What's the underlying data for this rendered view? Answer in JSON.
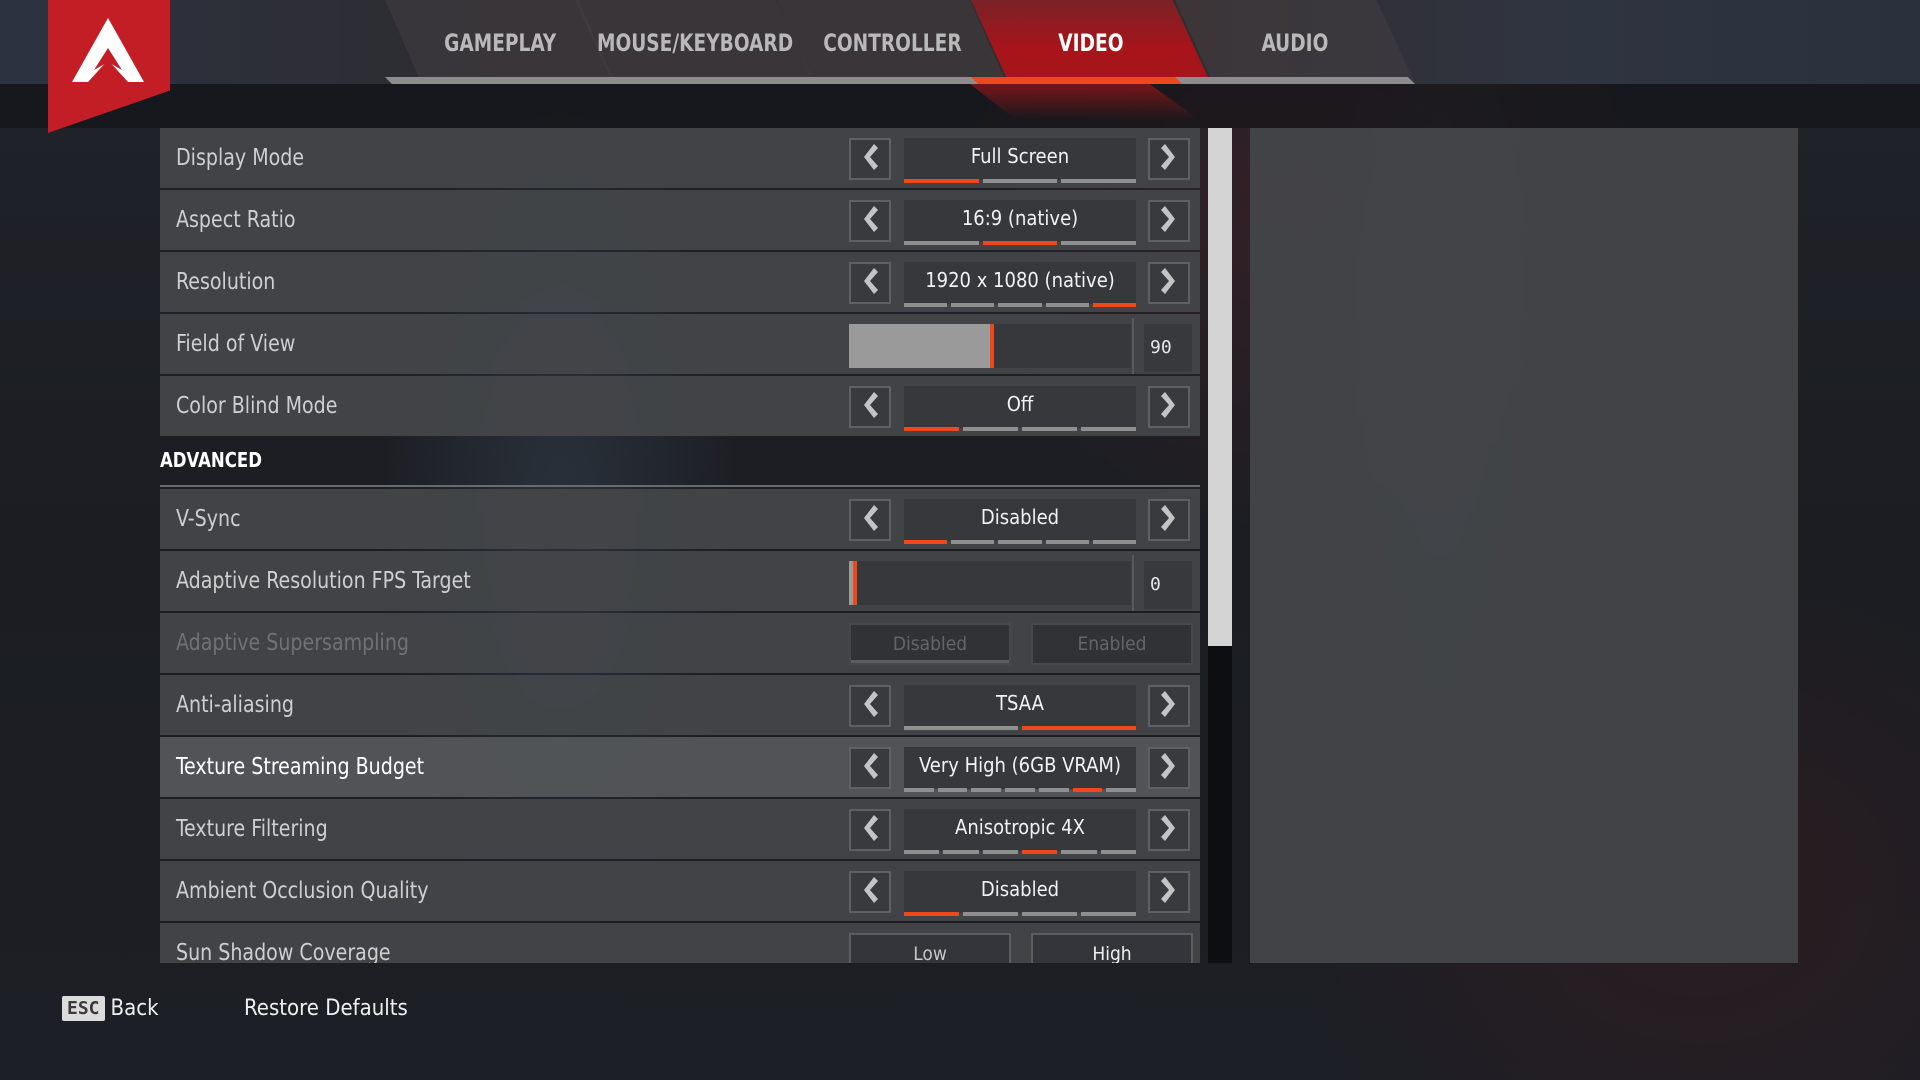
{
  "logo": {
    "icon": "apex-logo-icon",
    "color": "#c31d26"
  },
  "tabs": [
    {
      "label": "GAMEPLAY",
      "active": false
    },
    {
      "label": "MOUSE/KEYBOARD",
      "active": false
    },
    {
      "label": "CONTROLLER",
      "active": false
    },
    {
      "label": "VIDEO",
      "active": true
    },
    {
      "label": "AUDIO",
      "active": false
    }
  ],
  "accent_color": "#f0481d",
  "settings": {
    "display_mode": {
      "label": "Display Mode",
      "value": "Full Screen",
      "option_count": 3,
      "selected_index": 0
    },
    "aspect_ratio": {
      "label": "Aspect Ratio",
      "value": "16:9 (native)",
      "option_count": 3,
      "selected_index": 1
    },
    "resolution": {
      "label": "Resolution",
      "value": "1920 x 1080 (native)",
      "option_count": 5,
      "selected_index": 4
    },
    "field_of_view": {
      "label": "Field of View",
      "value": "90",
      "fill_fraction": 0.5
    },
    "color_blind_mode": {
      "label": "Color Blind Mode",
      "value": "Off",
      "option_count": 4,
      "selected_index": 0
    }
  },
  "advanced": {
    "title": "ADVANCED",
    "vsync": {
      "label": "V-Sync",
      "value": "Disabled",
      "option_count": 5,
      "selected_index": 0
    },
    "adaptive_res": {
      "label": "Adaptive Resolution FPS Target",
      "value": "0",
      "fill_fraction": 0.0
    },
    "adaptive_supersampling": {
      "label": "Adaptive Supersampling",
      "disabled": true,
      "options": [
        "Disabled",
        "Enabled"
      ],
      "selected": "Disabled"
    },
    "anti_aliasing": {
      "label": "Anti-aliasing",
      "value": "TSAA",
      "option_count": 2,
      "selected_index": 1
    },
    "texture_streaming": {
      "label": "Texture Streaming Budget",
      "value": "Very High (6GB VRAM)",
      "option_count": 7,
      "selected_index": 5,
      "highlighted": true
    },
    "texture_filtering": {
      "label": "Texture Filtering",
      "value": "Anisotropic 4X",
      "option_count": 6,
      "selected_index": 3
    },
    "ambient_occlusion": {
      "label": "Ambient Occlusion Quality",
      "value": "Disabled",
      "option_count": 4,
      "selected_index": 0
    },
    "sun_shadow": {
      "label": "Sun Shadow Coverage",
      "options": [
        "Low",
        "High"
      ],
      "selected": "High"
    }
  },
  "scrollbar": {
    "visible_fraction": 0.62,
    "position_fraction": 0.0
  },
  "footer": {
    "esc_key": "ESC",
    "back_label": "Back",
    "restore_label": "Restore Defaults"
  }
}
